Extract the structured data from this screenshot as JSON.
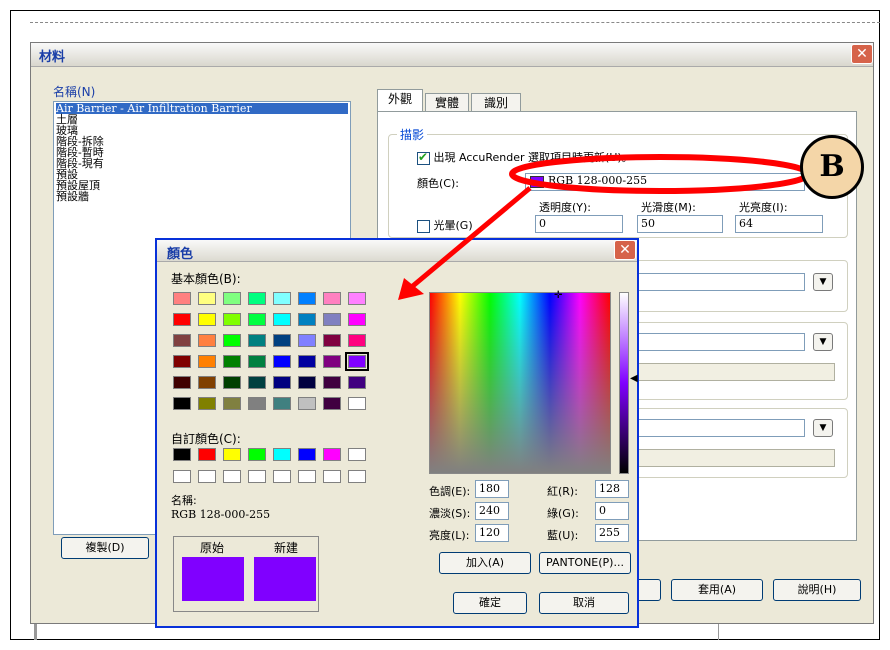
{
  "material_dialog": {
    "title": "材料",
    "close_glyph": "✕",
    "name_label": "名稱(N)",
    "materials": [
      "Air Barrier - Air Infiltration Barrier",
      "土層",
      "玻璃",
      "階段-拆除",
      "階段-暫時",
      "階段-現有",
      "預設",
      "預設屋頂",
      "預設牆"
    ],
    "copy_button": "複製(D)",
    "apply_button": "套用(A)",
    "help_button": "說明(H)",
    "tabs": [
      "外觀",
      "實體",
      "識別"
    ],
    "shading": {
      "group_title": "描影",
      "accurender_checkbox": "出現 AccuRender 選取項目時更新(U)。",
      "accurender_checked": true,
      "color_label": "顏色(C):",
      "color_value": "RGB 128-000-255",
      "color_hex": "#8000ff",
      "transparency_label": "透明度(Y):",
      "transparency_value": "0",
      "smoothness_label": "光滑度(M):",
      "smoothness_value": "50",
      "luminance_label": "光亮度(I):",
      "luminance_value": "64",
      "glow_label": "光暈(G)",
      "glow_checked": false
    }
  },
  "color_dialog": {
    "title": "顏色",
    "close_glyph": "✕",
    "basic_colors_label": "基本顏色(B):",
    "basic_colors": [
      [
        "#ff8080",
        "#ffff80",
        "#80ff80",
        "#00ff80",
        "#80ffff",
        "#0080ff",
        "#ff80c0",
        "#ff80ff"
      ],
      [
        "#ff0000",
        "#ffff00",
        "#80ff00",
        "#00ff40",
        "#00ffff",
        "#0080c0",
        "#8080c0",
        "#ff00ff"
      ],
      [
        "#804040",
        "#ff8040",
        "#00ff00",
        "#008080",
        "#004080",
        "#8080ff",
        "#800040",
        "#ff0080"
      ],
      [
        "#800000",
        "#ff8000",
        "#008000",
        "#008040",
        "#0000ff",
        "#0000a0",
        "#800080",
        "#8000ff"
      ],
      [
        "#400000",
        "#804000",
        "#004000",
        "#004040",
        "#000080",
        "#000040",
        "#400040",
        "#400080"
      ],
      [
        "#000000",
        "#808000",
        "#808040",
        "#808080",
        "#408080",
        "#c0c0c0",
        "#400040",
        "#ffffff"
      ]
    ],
    "custom_colors_label": "自訂顏色(C):",
    "custom_colors": [
      [
        "#000000",
        "#ff0000",
        "#ffff00",
        "#00ff00",
        "#00ffff",
        "#0000ff",
        "#ff00ff",
        "#ffffff"
      ],
      [
        "#ffffff",
        "#ffffff",
        "#ffffff",
        "#ffffff",
        "#ffffff",
        "#ffffff",
        "#ffffff",
        "#ffffff"
      ]
    ],
    "name_label": "名稱:",
    "name_value": "RGB 128-000-255",
    "original_label": "原始",
    "new_label": "新建",
    "original_color": "#8000ff",
    "new_color": "#8000ff",
    "hue_label": "色調(E):",
    "hue_value": "180",
    "sat_label": "濃淡(S):",
    "sat_value": "240",
    "lum_label": "亮度(L):",
    "lum_value": "120",
    "red_label": "紅(R):",
    "red_value": "128",
    "green_label": "綠(G):",
    "green_value": "0",
    "blue_label": "藍(U):",
    "blue_value": "255",
    "add_button": "加入(A)",
    "pantone_button": "PANTONE(P)...",
    "ok_button": "確定",
    "cancel_button": "取消"
  },
  "callout_label": "B",
  "annotation_color": "#ff0000"
}
